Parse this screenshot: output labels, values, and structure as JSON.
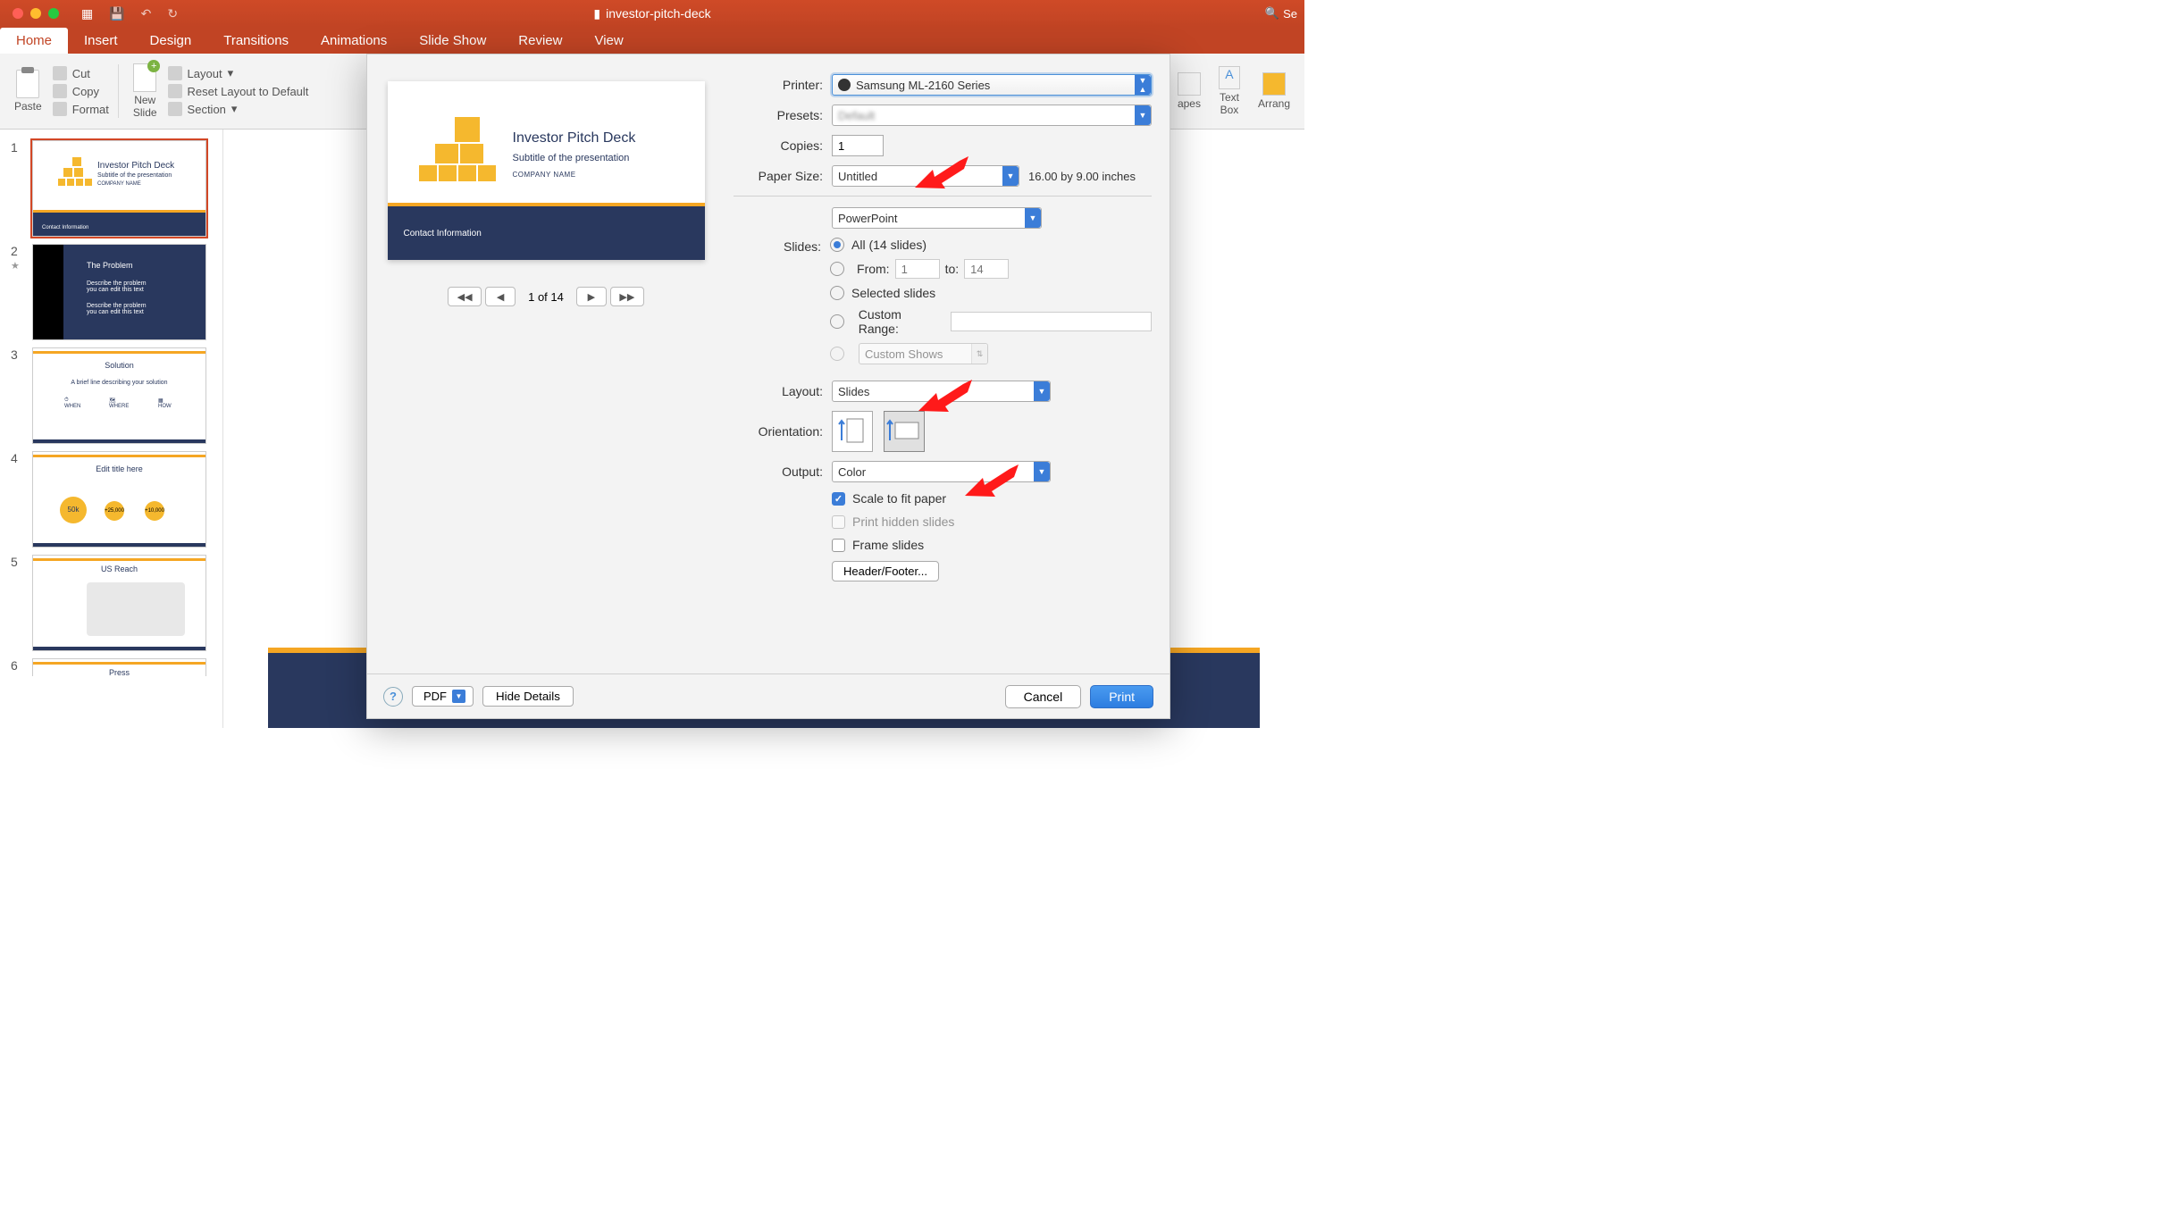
{
  "window": {
    "title": "investor-pitch-deck",
    "search_placeholder": "Se"
  },
  "tabs": [
    "Home",
    "Insert",
    "Design",
    "Transitions",
    "Animations",
    "Slide Show",
    "Review",
    "View"
  ],
  "ribbon": {
    "paste": "Paste",
    "cut": "Cut",
    "copy": "Copy",
    "format": "Format",
    "new_slide": "New\nSlide",
    "layout": "Layout",
    "reset": "Reset Layout to Default",
    "section": "Section",
    "shapes": "apes",
    "textbox": "Text\nBox",
    "arrange": "Arrang"
  },
  "thumbnails": [
    {
      "n": "1",
      "title": "Investor Pitch Deck",
      "sub": "Subtitle of the presentation",
      "co": "COMPANY NAME"
    },
    {
      "n": "2",
      "title": "The Problem"
    },
    {
      "n": "3",
      "title": "Solution",
      "sub": "A brief line describing your solution"
    },
    {
      "n": "4",
      "title": "Edit title here"
    },
    {
      "n": "5",
      "title": "US Reach"
    },
    {
      "n": "6",
      "title": "Press"
    }
  ],
  "preview": {
    "title": "Investor Pitch Deck",
    "subtitle": "Subtitle of the presentation",
    "company": "COMPANY NAME",
    "contact": "Contact Information",
    "pager": "1 of 14"
  },
  "print": {
    "printer_label": "Printer:",
    "printer_value": "Samsung ML-2160 Series",
    "presets_label": "Presets:",
    "presets_value": "",
    "copies_label": "Copies:",
    "copies_value": "1",
    "papersize_label": "Paper Size:",
    "papersize_value": "Untitled",
    "papersize_dims": "16.00 by 9.00 inches",
    "app_dropdown": "PowerPoint",
    "slides_label": "Slides:",
    "all_label": "All  (14 slides)",
    "from_label": "From:",
    "from_value": "1",
    "to_label": "to:",
    "to_value": "14",
    "selected_label": "Selected slides",
    "custom_range_label": "Custom Range:",
    "custom_shows_label": "Custom Shows",
    "layout_label": "Layout:",
    "layout_value": "Slides",
    "orientation_label": "Orientation:",
    "output_label": "Output:",
    "output_value": "Color",
    "scale_label": "Scale to fit paper",
    "hidden_label": "Print hidden slides",
    "frame_label": "Frame slides",
    "header_footer": "Header/Footer..."
  },
  "footer": {
    "pdf": "PDF",
    "hide": "Hide Details",
    "cancel": "Cancel",
    "print": "Print"
  }
}
